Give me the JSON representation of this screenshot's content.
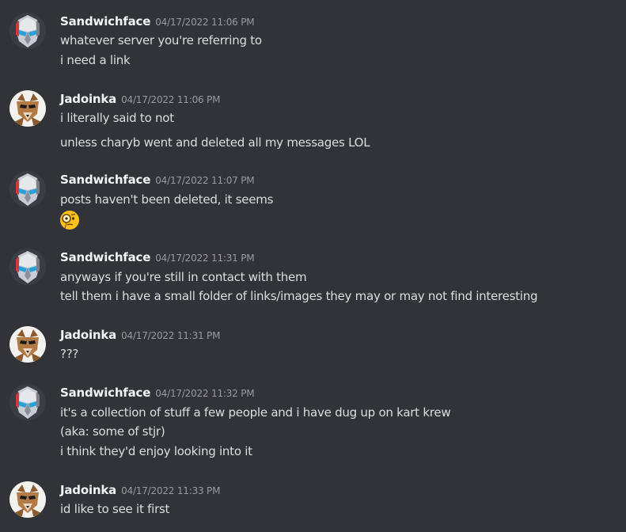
{
  "colors": {
    "background": "#313338",
    "username": "#f2f3f5",
    "timestamp": "#949ba4",
    "text": "#dbdee1"
  },
  "messages": [
    {
      "author": "Sandwichface",
      "avatar": "robot-avatar",
      "timestamp": "04/17/2022 11:06 PM",
      "lines": [
        "whatever server you're referring to",
        "i need a link"
      ]
    },
    {
      "author": "Jadoinka",
      "avatar": "fox-avatar",
      "timestamp": "04/17/2022 11:06 PM",
      "lines": [
        "i literally said to not",
        "unless charyb went and deleted all my messages LOL"
      ]
    },
    {
      "author": "Sandwichface",
      "avatar": "robot-avatar",
      "timestamp": "04/17/2022 11:07 PM",
      "lines": [
        "posts haven't been deleted, it seems"
      ],
      "emoji": "face-with-monocle-emoji"
    },
    {
      "author": "Sandwichface",
      "avatar": "robot-avatar",
      "timestamp": "04/17/2022 11:31 PM",
      "lines": [
        "anyways if you're still in contact with them",
        "tell them i have a small folder of links/images they may or may not find interesting"
      ]
    },
    {
      "author": "Jadoinka",
      "avatar": "fox-avatar",
      "timestamp": "04/17/2022 11:31 PM",
      "lines": [
        "???"
      ]
    },
    {
      "author": "Sandwichface",
      "avatar": "robot-avatar",
      "timestamp": "04/17/2022 11:32 PM",
      "lines": [
        "it's a collection of stuff a few people and i have dug up on kart krew",
        "(aka: some of stjr)",
        "i think they'd enjoy looking into it"
      ]
    },
    {
      "author": "Jadoinka",
      "avatar": "fox-avatar",
      "timestamp": "04/17/2022 11:33 PM",
      "lines": [
        "id like to see it first"
      ]
    }
  ]
}
